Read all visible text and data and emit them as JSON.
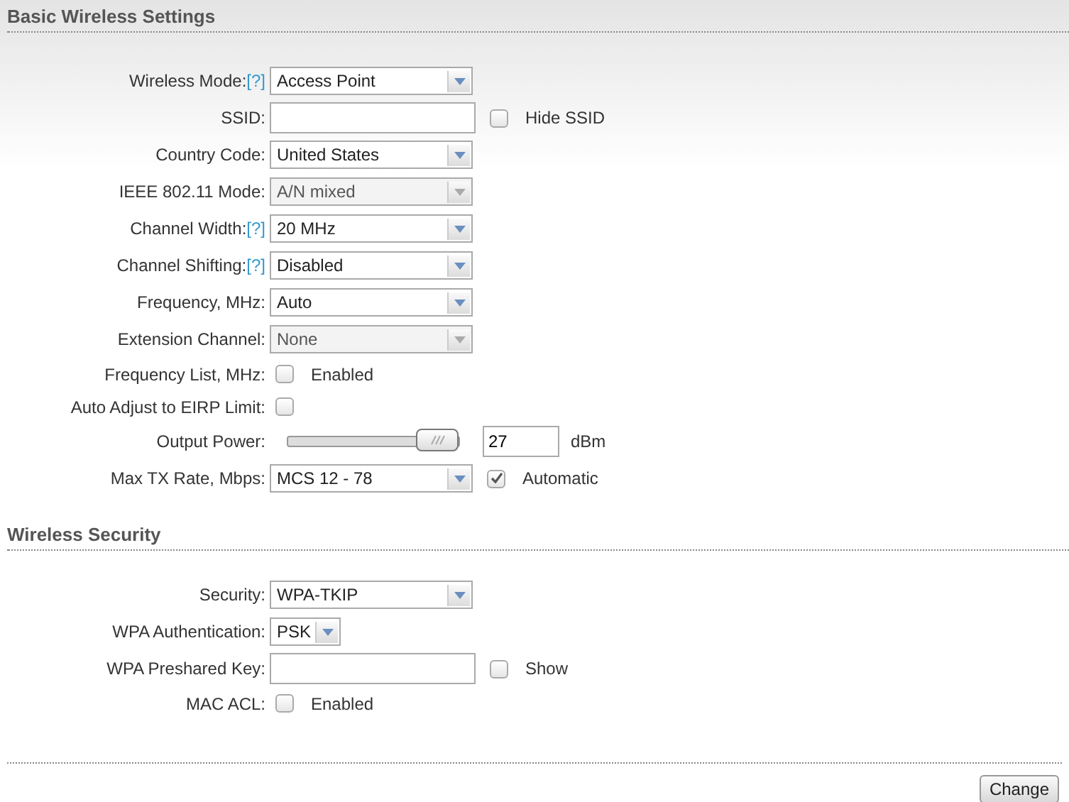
{
  "sections": [
    {
      "title": "Basic Wireless Settings",
      "rows": [
        {
          "kind": "select",
          "label": "Wireless Mode:",
          "help": "[?]",
          "value": "Access Point",
          "disabled": false
        },
        {
          "kind": "text",
          "label": "SSID:",
          "value": "",
          "check": {
            "label": "Hide SSID",
            "checked": false
          }
        },
        {
          "kind": "select",
          "label": "Country Code:",
          "value": "United States",
          "disabled": false
        },
        {
          "kind": "select",
          "label": "IEEE 802.11 Mode:",
          "value": "A/N mixed",
          "disabled": true
        },
        {
          "kind": "select",
          "label": "Channel Width:",
          "help": "[?]",
          "value": "20 MHz",
          "disabled": false
        },
        {
          "kind": "select",
          "label": "Channel Shifting:",
          "help": "[?]",
          "value": "Disabled",
          "disabled": false
        },
        {
          "kind": "select",
          "label": "Frequency, MHz:",
          "value": "Auto",
          "disabled": false
        },
        {
          "kind": "select",
          "label": "Extension Channel:",
          "value": "None",
          "disabled": true
        },
        {
          "kind": "checkbox",
          "label": "Frequency List, MHz:",
          "check": {
            "label": "Enabled",
            "checked": false
          }
        },
        {
          "kind": "checkbox",
          "label": "Auto Adjust to EIRP Limit:",
          "check": {
            "checked": false
          }
        },
        {
          "kind": "slider",
          "label": "Output Power:",
          "level": 1,
          "value": "27",
          "unit": "dBm"
        },
        {
          "kind": "select",
          "label": "Max TX Rate, Mbps:",
          "value": "MCS 12 - 78",
          "disabled": false,
          "check": {
            "label": "Automatic",
            "checked": true
          }
        }
      ]
    },
    {
      "title": "Wireless Security",
      "rows": [
        {
          "kind": "select",
          "label": "Security:",
          "value": "WPA-TKIP",
          "disabled": false
        },
        {
          "kind": "small-select",
          "label": "WPA Authentication:",
          "value": "PSK",
          "disabled": false
        },
        {
          "kind": "text",
          "label": "WPA Preshared Key:",
          "value": "",
          "check": {
            "label": "Show",
            "checked": false
          }
        },
        {
          "kind": "checkbox",
          "label": "MAC ACL:",
          "check": {
            "label": "Enabled",
            "checked": false
          }
        }
      ]
    }
  ],
  "button": "Change"
}
